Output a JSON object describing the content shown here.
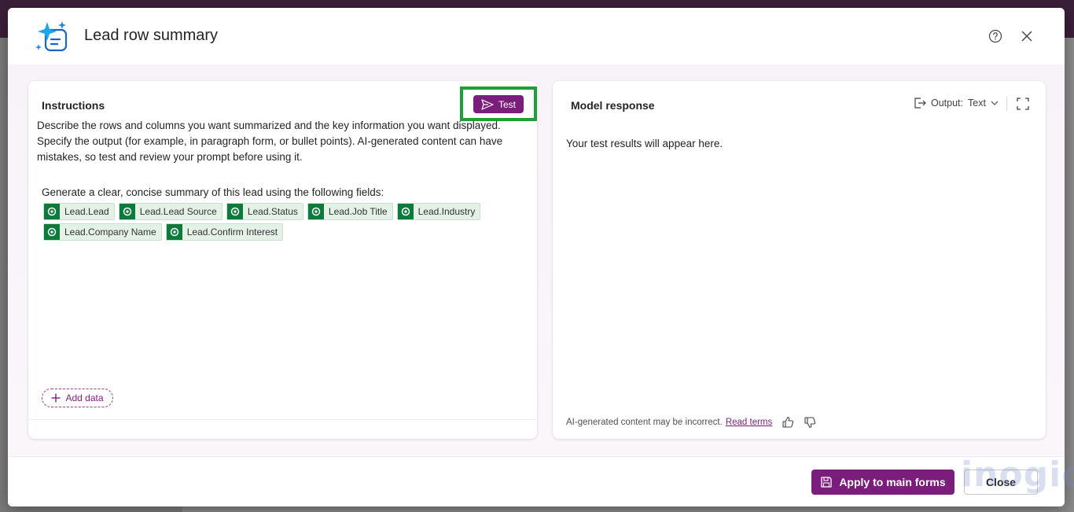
{
  "dialog": {
    "title": "Lead row summary",
    "help_icon": "question-circle-icon",
    "close_icon": "close-icon"
  },
  "instructions": {
    "title": "Instructions",
    "test_label": "Test",
    "description": "Describe the rows and columns you want summarized and the key information you want displayed. Specify the output (for example, in paragraph form, or bullet points). AI-generated content can have mistakes, so test and review your prompt before using it.",
    "prompt_intro": "Generate a clear, concise summary of this lead using the following fields:",
    "fields": [
      {
        "label": "Lead.Lead"
      },
      {
        "label": "Lead.Lead Source"
      },
      {
        "label": "Lead.Status"
      },
      {
        "label": "Lead.Job Title"
      },
      {
        "label": "Lead.Industry"
      },
      {
        "label": "Lead.Company Name"
      },
      {
        "label": "Lead.Confirm Interest"
      }
    ],
    "add_data_label": "Add data"
  },
  "response": {
    "title": "Model response",
    "output_label": "Output:",
    "output_value": "Text",
    "placeholder": "Your test results will appear here.",
    "disclaimer": "AI-generated content may be incorrect.",
    "read_terms": "Read terms"
  },
  "footer": {
    "apply_label": "Apply to main forms",
    "close_label": "Close"
  },
  "colors": {
    "accent": "#7b1d7b",
    "highlight": "#1f9e3a",
    "chip_bg": "#e4f1e6",
    "chip_icon": "#0b7a3b"
  },
  "watermark": "inogic"
}
